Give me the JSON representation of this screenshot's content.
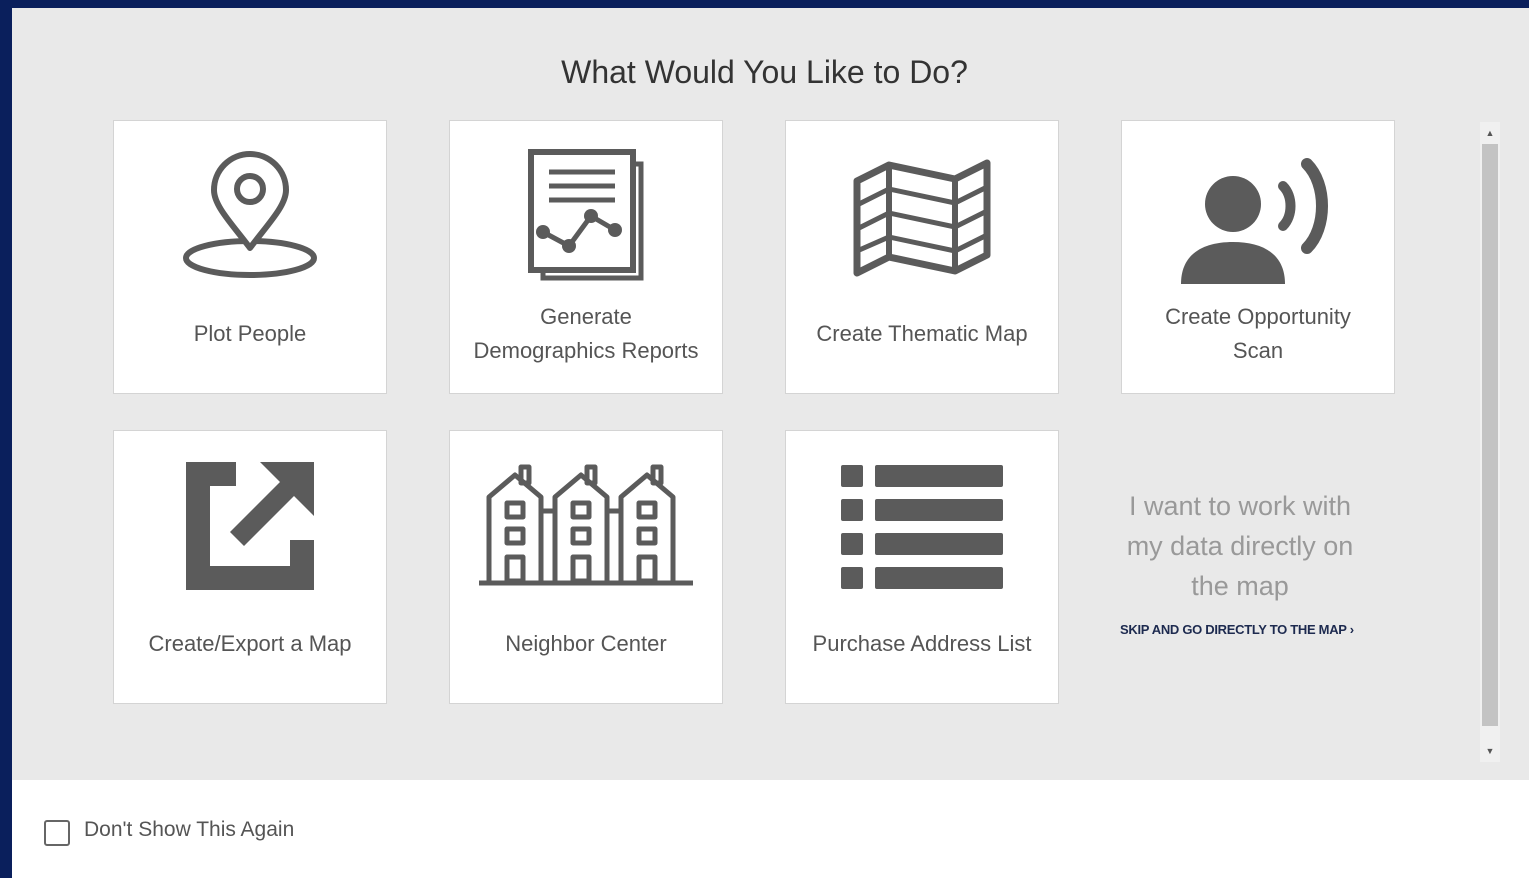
{
  "dialog": {
    "title": "What Would You Like to Do?"
  },
  "cards": [
    {
      "id": "plot-people",
      "label": "Plot People",
      "icon": "map-pin-icon"
    },
    {
      "id": "demographics",
      "label_line1": "Generate",
      "label_line2": "Demographics Reports",
      "icon": "report-chart-icon"
    },
    {
      "id": "thematic-map",
      "label": "Create Thematic Map",
      "icon": "folded-map-icon"
    },
    {
      "id": "opportunity-scan",
      "label_line1": "Create Opportunity",
      "label_line2": "Scan",
      "icon": "person-broadcast-icon"
    },
    {
      "id": "export-map",
      "label": "Create/Export a Map",
      "icon": "external-link-icon"
    },
    {
      "id": "neighbor-center",
      "label": "Neighbor Center",
      "icon": "townhouses-icon"
    },
    {
      "id": "address-list",
      "label": "Purchase Address List",
      "icon": "list-icon"
    }
  ],
  "side": {
    "text_line1": "I want to work with",
    "text_line2": "my data directly on",
    "text_line3": "the map",
    "skip_link": "SKIP AND GO DIRECTLY TO THE MAP ›"
  },
  "footer": {
    "checkbox_label": "Don't Show This Again",
    "checked": false
  },
  "colors": {
    "icon": "#5b5b5b",
    "background": "#e9e9e9",
    "frame": "#0a1f5c",
    "link": "#1d2a4f"
  }
}
